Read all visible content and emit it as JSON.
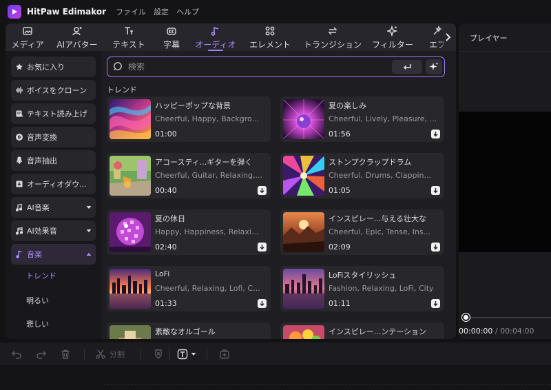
{
  "app": {
    "title": "HitPaw Edimakor",
    "menu": [
      "ファイル",
      "設定",
      "ヘルプ"
    ]
  },
  "categories": [
    {
      "label": "メディア",
      "icon": "image-icon"
    },
    {
      "label": "AIアバター",
      "icon": "avatar-icon"
    },
    {
      "label": "テキスト",
      "icon": "text-icon"
    },
    {
      "label": "字幕",
      "icon": "caption-icon"
    },
    {
      "label": "オーディオ",
      "icon": "music-note-icon",
      "active": true
    },
    {
      "label": "エレメント",
      "icon": "elements-icon"
    },
    {
      "label": "トランジション",
      "icon": "transition-icon"
    },
    {
      "label": "フィルター",
      "icon": "filter-icon"
    },
    {
      "label": "エフ",
      "icon": "effects-icon"
    }
  ],
  "sidebar": {
    "items": [
      {
        "label": "お気に入り",
        "icon": "star-icon"
      },
      {
        "label": "ボイスをクローン",
        "icon": "waveform-icon"
      },
      {
        "label": "テキスト読み上げ",
        "icon": "text-to-speech-icon"
      },
      {
        "label": "音声変換",
        "icon": "voice-change-icon"
      },
      {
        "label": "音声抽出",
        "icon": "microphone-icon"
      },
      {
        "label": "オーディオダウ...",
        "icon": "download-box-icon"
      },
      {
        "label": "AI音楽",
        "icon": "ai-music-icon",
        "caret": "down"
      },
      {
        "label": "AI効果音",
        "icon": "ai-sfx-icon",
        "caret": "down"
      },
      {
        "label": "音楽",
        "icon": "music-note-icon",
        "caret": "up",
        "active": true
      }
    ],
    "sub_items": [
      {
        "label": "トレンド",
        "active": true
      },
      {
        "label": "明るい"
      },
      {
        "label": "悲しい"
      }
    ]
  },
  "search": {
    "placeholder": "検索",
    "value": ""
  },
  "section_title": "トレンド",
  "tracks": [
    {
      "title": "ハッピーポップな背景",
      "tags": "Cheerful, Happy, Backgro...",
      "duration": "01:00",
      "thumb": "colorful-wave",
      "download": false
    },
    {
      "title": "夏の楽しみ",
      "tags": "Cheerful, Lively, Pleasure, ...",
      "duration": "01:56",
      "thumb": "disco-burst",
      "download": true
    },
    {
      "title": "アコースティ...ギターを弾く",
      "tags": "Cheerful, Guitar, Relaxing,...",
      "duration": "00:40",
      "thumb": "guitar-street",
      "download": true
    },
    {
      "title": "ストンプクラップドラム",
      "tags": "Cheerful, Drums, Clappin...",
      "duration": "01:05",
      "thumb": "color-explosion",
      "download": true
    },
    {
      "title": "夏の休日",
      "tags": "Happy, Happiness, Relaxi...",
      "duration": "02:40",
      "thumb": "disco-ball",
      "download": true
    },
    {
      "title": "インスピレー...与える壮大な",
      "tags": "Cheerful, Epic, Tense, Ins...",
      "duration": "02:09",
      "thumb": "epic-landscape",
      "download": true
    },
    {
      "title": "LoFi",
      "tags": "Cheerful, Relaxing, Lofi, C...",
      "duration": "01:33",
      "thumb": "city-sunset",
      "download": true
    },
    {
      "title": "LoFiスタイリッシュ",
      "tags": "Fashion, Relaxing, LoFi, City",
      "duration": "01:11",
      "thumb": "city-dusk",
      "download": true
    },
    {
      "title": "素敵なオルゴール",
      "tags": "",
      "duration": "",
      "thumb": "music-box",
      "download": false
    },
    {
      "title": "インスピレー...ンテーション",
      "tags": "",
      "duration": "",
      "thumb": "fruit-still",
      "download": false
    }
  ],
  "player": {
    "title": "プレイヤー",
    "current_time": "00:00:00",
    "separator": " / ",
    "total_time": "00:04:00",
    "progress": 0
  },
  "toolbar": {
    "split_label": "分割"
  },
  "colors": {
    "accent": "#a67cff",
    "background": "#121214",
    "panel": "#1d1d22",
    "card": "#27272c"
  }
}
